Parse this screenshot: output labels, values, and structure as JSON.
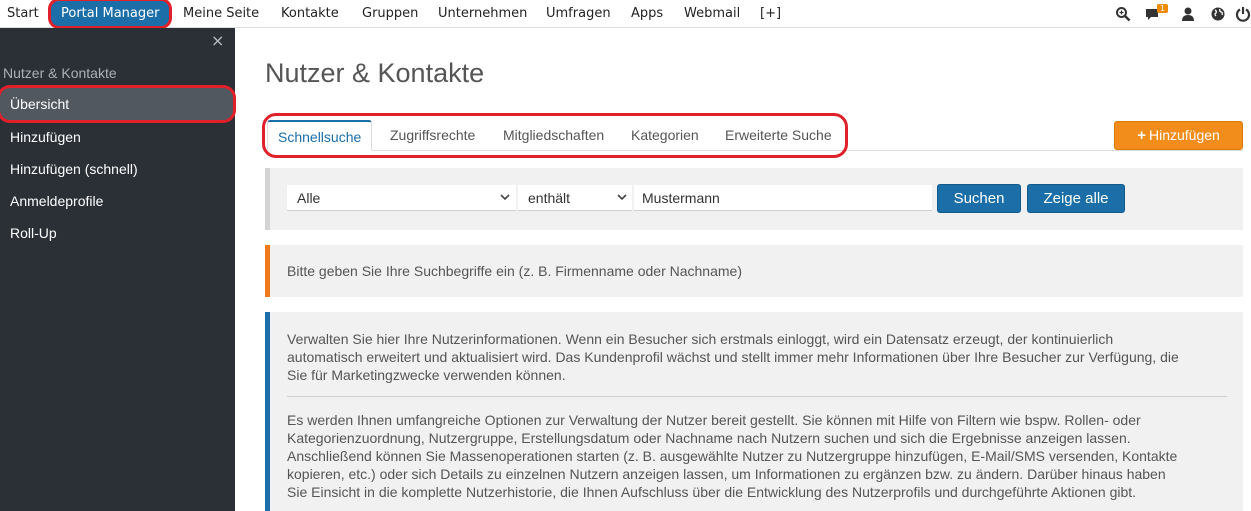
{
  "topnav": {
    "items": [
      "Start",
      "Portal Manager",
      "Meine Seite",
      "Kontakte",
      "Gruppen",
      "Unternehmen",
      "Umfragen",
      "Apps",
      "Webmail",
      "[+]"
    ],
    "badge_count": "1"
  },
  "sidebar": {
    "close": "×",
    "title": "Nutzer & Kontakte",
    "items": [
      "Übersicht",
      "Hinzufügen",
      "Hinzufügen (schnell)",
      "Anmeldeprofile",
      "Roll-Up"
    ]
  },
  "main": {
    "title": "Nutzer & Kontakte",
    "tabs": [
      "Schnellsuche",
      "Zugriffsrechte",
      "Mitgliedschaften",
      "Kategorien",
      "Erweiterte Suche"
    ],
    "add_button": "Hinzufügen",
    "search": {
      "field_select": "Alle",
      "operator_select": "enthält",
      "query_value": "Mustermann",
      "search_button": "Suchen",
      "show_all_button": "Zeige alle"
    },
    "hint": "Bitte geben Sie Ihre Suchbegriffe ein (z. B. Firmenname oder Nachname)",
    "info": {
      "p1": [
        "Verwalten Sie hier Ihre Nutzerinformationen. Wenn ein Besucher sich erstmals einloggt, wird ein Datensatz erzeugt, der kontinuierlich",
        "automatisch erweitert und aktualisiert wird. Das Kundenprofil wächst und stellt immer mehr Informationen über Ihre Besucher zur Verfügung, die",
        "Sie für Marketingzwecke verwenden können."
      ],
      "p2": [
        "Es werden Ihnen umfangreiche Optionen zur Verwaltung der Nutzer bereit gestellt. Sie können mit Hilfe von Filtern wie bspw. Rollen- oder",
        "Kategorienzuordnung, Nutzergruppe, Erstellungsdatum oder Nachname nach Nutzern suchen und sich die Ergebnisse anzeigen lassen.",
        "Anschließend können Sie Massenoperationen starten (z. B. ausgewählte Nutzer zu Nutzergruppe hinzufügen, E-Mail/SMS versenden, Kontakte",
        "kopieren, etc.) oder sich Details zu einzelnen Nutzern anzeigen lassen, um Informationen zu ergänzen bzw. zu ändern. Darüber hinaus haben",
        "Sie Einsicht in die komplette Nutzerhistorie, die Ihnen Aufschluss über die Entwicklung des Nutzerprofils und durchgeführte Aktionen gibt."
      ]
    }
  },
  "icons": [
    "search-icon",
    "notifications-icon",
    "user-icon",
    "language-icon",
    "power-icon"
  ],
  "colors": {
    "primary": "#1b6ea8",
    "accent": "#f28c1b",
    "highlight": "#e0202a",
    "sidebar_bg": "#2b3036"
  }
}
